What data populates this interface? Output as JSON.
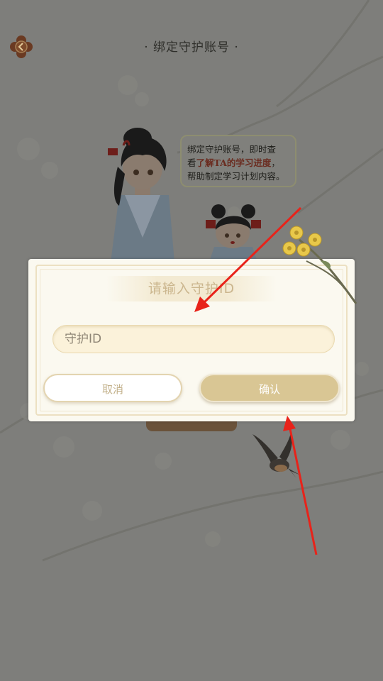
{
  "header": {
    "title": "· 绑定守护账号 ·"
  },
  "speech_bubble": {
    "line1": "绑定守护账号，即时查",
    "line2_prefix": "看",
    "line2_highlight": "了解TA的学习进度",
    "line2_suffix": "，",
    "line3": "帮助制定学习计划内容。"
  },
  "dialog": {
    "title": "请输入守护ID",
    "input": {
      "placeholder": "守护ID",
      "value": ""
    },
    "cancel_label": "取消",
    "confirm_label": "确认"
  },
  "colors": {
    "overlay": "#7e7e7b",
    "dialog_bg": "#fbf9f0",
    "accent_gold": "#d9c694",
    "annotation_arrow": "#e8231a"
  },
  "icons": [
    "back-icon",
    "flower-icon",
    "swallow-bird-icon"
  ]
}
